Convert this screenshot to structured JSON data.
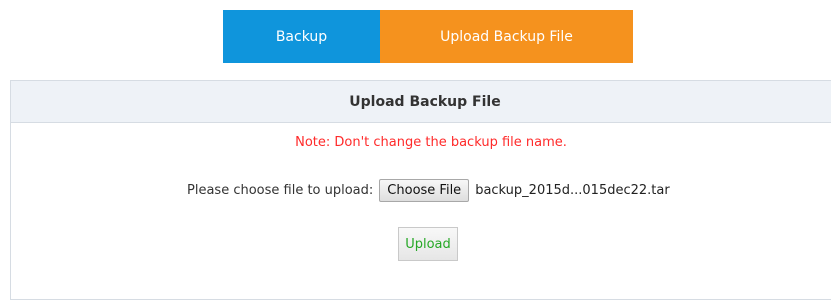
{
  "tabs": {
    "backup_label": "Backup",
    "upload_label": "Upload Backup File",
    "active": "Upload Backup File"
  },
  "panel": {
    "title": "Upload Backup File",
    "note": "Note: Don't change the backup file name.",
    "choose_label": "Please choose file to upload:",
    "choose_button": "Choose File",
    "selected_file": "backup_2015d...015dec22.tar",
    "upload_button": "Upload"
  },
  "colors": {
    "tab_backup": "#0f95dc",
    "tab_upload_active": "#f5921e",
    "note_text": "#ff2a2a",
    "upload_text": "#26a826"
  }
}
